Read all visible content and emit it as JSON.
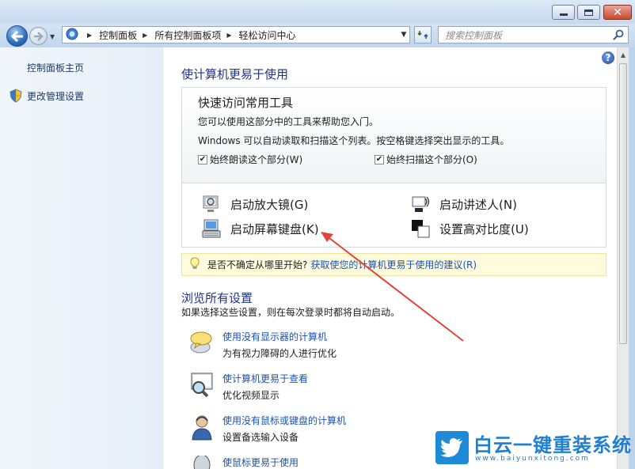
{
  "window": {
    "close_glyph": "✕"
  },
  "nav": {
    "breadcrumbs": [
      "控制面板",
      "所有控制面板项",
      "轻松访问中心"
    ],
    "search_placeholder": "搜索控制面板"
  },
  "sidebar": {
    "items": [
      {
        "label": "控制面板主页"
      },
      {
        "label": "更改管理设置",
        "icon": "shield-icon"
      }
    ]
  },
  "main": {
    "title": "使计算机更易于使用",
    "help_glyph": "?",
    "quick": {
      "title": "快速访问常用工具",
      "desc1": "您可以使用这部分中的工具来帮助您入门。",
      "desc2": "Windows 可以自动读取和扫描这个列表。按空格键选择突出显示的工具。",
      "check_read": {
        "label": "始终朗读这个部分(W)",
        "checked": true
      },
      "check_scan": {
        "label": "始终扫描这个部分(O)",
        "checked": true
      },
      "tools": {
        "magnifier": "启动放大镜(G)",
        "osk": "启动屏幕键盘(K)",
        "narrator": "启动讲述人(N)",
        "contrast": "设置高对比度(U)"
      }
    },
    "tip": {
      "text": "是否不确定从哪里开始?",
      "link": "获取使您的计算机更易于使用的建议(R)"
    },
    "browse": {
      "title": "浏览所有设置",
      "desc": "如果选择这些设置，则在每次登录时都将自动启动。",
      "items": [
        {
          "link": "使用没有显示器的计算机",
          "desc": "为有视力障碍的人进行优化"
        },
        {
          "link": "使计算机更易于查看",
          "desc": "优化视频显示"
        },
        {
          "link": "使用没有鼠标或键盘的计算机",
          "desc": "设置备选输入设备"
        },
        {
          "link": "使鼠标更易于使用",
          "desc": ""
        }
      ]
    }
  },
  "watermark": {
    "name": "白云一键重装系统",
    "url": "www.baiyunxitong.com"
  },
  "colors": {
    "link": "#1a52b5",
    "heading": "#1e3287",
    "annotation_arrow": "#e0443a",
    "brand": "#1f7fd0"
  }
}
